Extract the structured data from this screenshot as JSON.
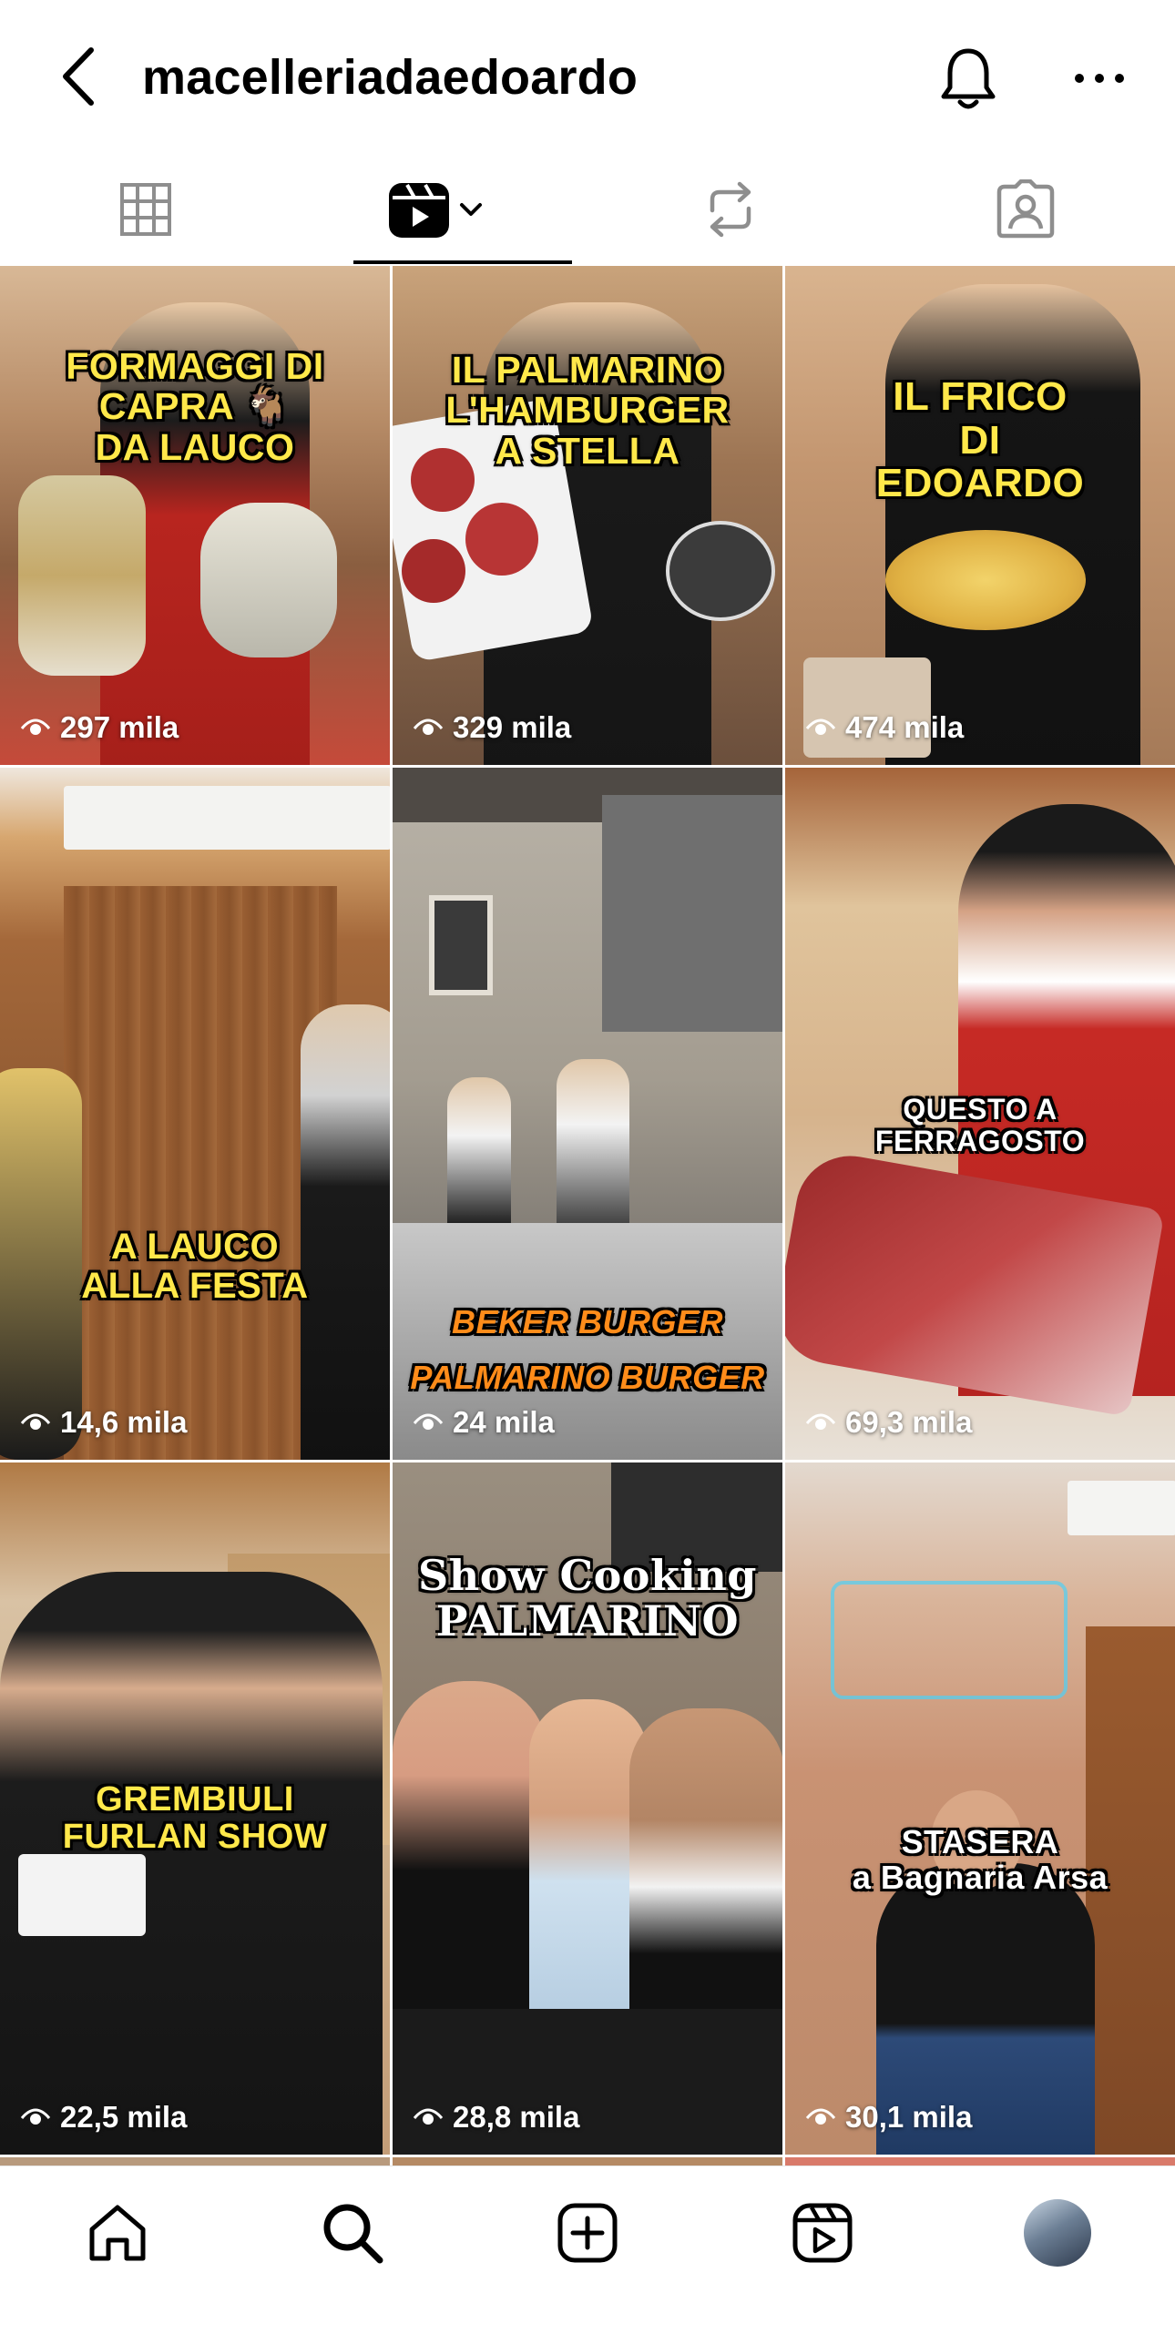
{
  "header": {
    "username": "macelleriadaedoardo"
  },
  "tabs": [
    {
      "icon": "grid-icon",
      "active": false
    },
    {
      "icon": "reels-icon",
      "active": true
    },
    {
      "icon": "reposts-icon",
      "active": false
    },
    {
      "icon": "tagged-icon",
      "active": false
    }
  ],
  "reels": [
    {
      "caption": "FORMAGGI DI\nCAPRA 🐐\nDA LAUCO",
      "views": "297 mila"
    },
    {
      "caption": "IL PALMARINO\nL'HAMBURGER\nA STELLA",
      "views": "329 mila"
    },
    {
      "caption": "IL FRICO\nDI\nEDOARDO",
      "views": "474 mila"
    },
    {
      "caption": "A LAUCO\nALLA FESTA",
      "views": "14,6 mila"
    },
    {
      "caption": "BEKER BURGER\nPALMARINO BURGER",
      "views": "24 mila"
    },
    {
      "caption": "QUESTO A\nFERRAGOSTO",
      "views": "69,3 mila"
    },
    {
      "caption": "GREMBIULI\nFURLAN SHOW",
      "views": "22,5 mila"
    },
    {
      "caption": "Show Cooking\nPALMARINO",
      "views": "28,8 mila"
    },
    {
      "caption": "STASERA\na Bagnaria Arsa",
      "views": "30,1 mila"
    }
  ],
  "colors": {
    "caption_yellow": "#ffe84a",
    "active_tab": "#000000",
    "icon_gray": "#8e8e8e"
  }
}
